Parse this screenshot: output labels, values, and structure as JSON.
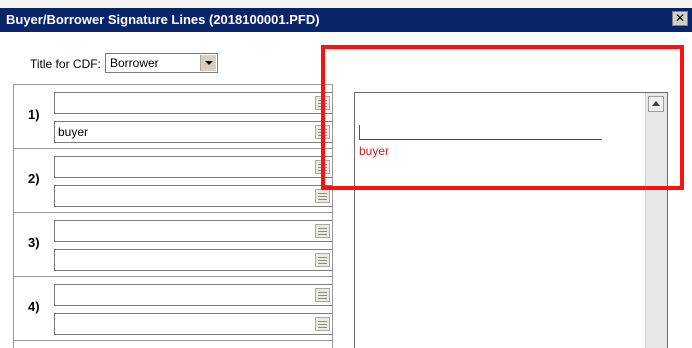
{
  "window": {
    "title": "Buyer/Borrower Signature Lines (2018100001.PFD)",
    "close_glyph": "✕",
    "title_bg": "#0a246a"
  },
  "cdf": {
    "label": "Title for CDF:",
    "selected": "Borrower"
  },
  "groups": [
    {
      "label": "1)",
      "line1": "",
      "line2": "buyer"
    },
    {
      "label": "2)",
      "line1": "",
      "line2": ""
    },
    {
      "label": "3)",
      "line1": "",
      "line2": ""
    },
    {
      "label": "4)",
      "line1": "",
      "line2": ""
    }
  ],
  "preview": {
    "signature_name": "buyer",
    "signature_color": "#c81e1e"
  },
  "annotation": {
    "highlight_color": "#ff1010"
  }
}
